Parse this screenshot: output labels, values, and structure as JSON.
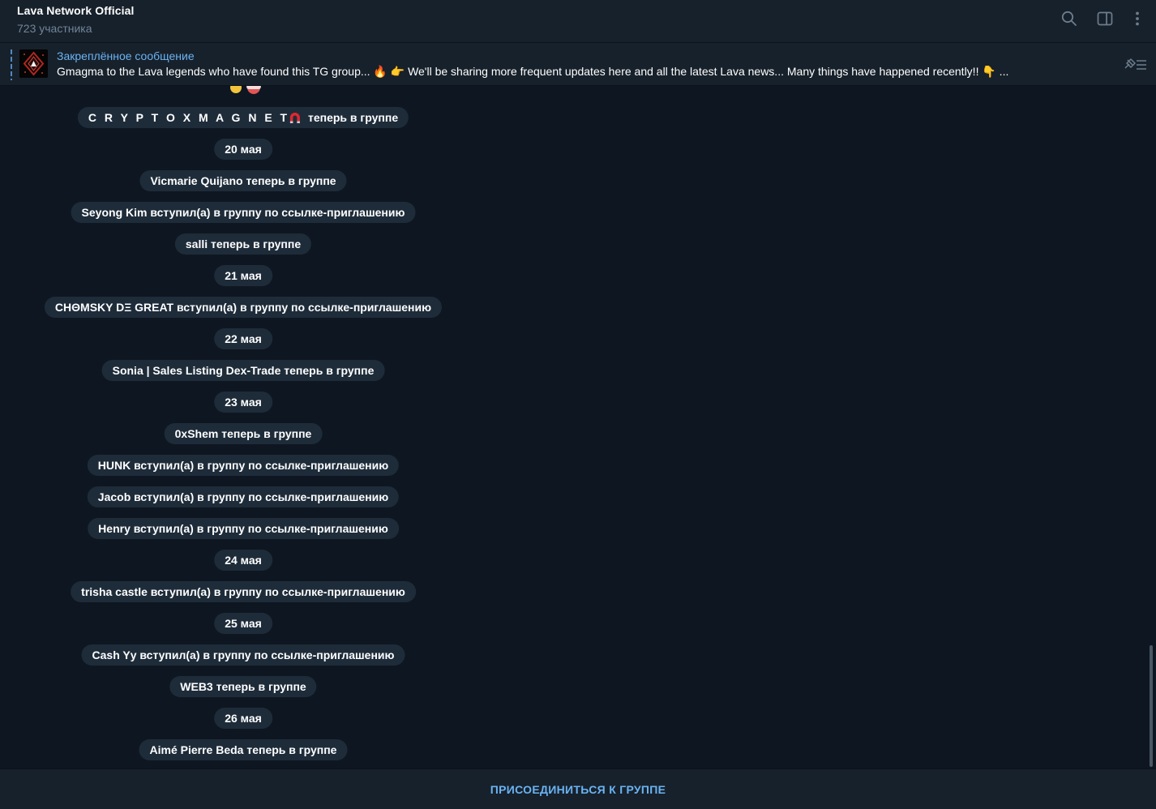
{
  "header": {
    "title": "Lava Network Official",
    "members": "723 участника",
    "icons": [
      "search-icon",
      "sidebar-toggle-icon",
      "more-vertical-icon"
    ]
  },
  "pinned": {
    "label": "Закреплённое сообщение",
    "text": "Gmagma to the Lava legends who have found this TG group... 🔥  👉 We'll be sharing more frequent updates here and all the latest Lava news...  Many things have happened recently!! 👇  ..."
  },
  "messages": [
    {
      "type": "service",
      "name": "C R Y P T O X M A G N E T",
      "suffix": " теперь в группе",
      "icon": "magnet"
    },
    {
      "type": "date",
      "text": "20 мая"
    },
    {
      "type": "service",
      "text": "Vicmarie Quijano теперь в группе"
    },
    {
      "type": "service",
      "text": "Seyong Kim вступил(а) в группу по ссылке-приглашению"
    },
    {
      "type": "service",
      "text": "salli теперь в группе"
    },
    {
      "type": "date",
      "text": "21 мая"
    },
    {
      "type": "service",
      "text": "CHΘMSKY DΞ GREAT вступил(а) в группу по ссылке-приглашению"
    },
    {
      "type": "date",
      "text": "22 мая"
    },
    {
      "type": "service",
      "text": "Sonia | Sales Listing Dex-Trade теперь в группе"
    },
    {
      "type": "date",
      "text": "23 мая"
    },
    {
      "type": "service",
      "text": "0xShem теперь в группе"
    },
    {
      "type": "service",
      "text": "HUNK вступил(а) в группу по ссылке-приглашению"
    },
    {
      "type": "service",
      "text": "Jacob вступил(а) в группу по ссылке-приглашению"
    },
    {
      "type": "service",
      "text": "Henry вступил(а) в группу по ссылке-приглашению"
    },
    {
      "type": "date",
      "text": "24 мая"
    },
    {
      "type": "service",
      "text": "trisha castle вступил(а) в группу по ссылке-приглашению"
    },
    {
      "type": "date",
      "text": "25 мая"
    },
    {
      "type": "service",
      "text": "Cash Yy вступил(а) в группу по ссылке-приглашению"
    },
    {
      "type": "service",
      "text": "WEB3 теперь в группе"
    },
    {
      "type": "date",
      "text": "26 мая"
    },
    {
      "type": "service",
      "text": "Aimé Pierre Beda теперь в группе"
    }
  ],
  "footer": {
    "join_label": "ПРИСОЕДИНИТЬСЯ К ГРУППЕ"
  },
  "colors": {
    "background": "#0e1621",
    "panel": "#17212b",
    "bubble": "#1e2c3a",
    "accent": "#6ab3f3",
    "muted": "#708499"
  }
}
